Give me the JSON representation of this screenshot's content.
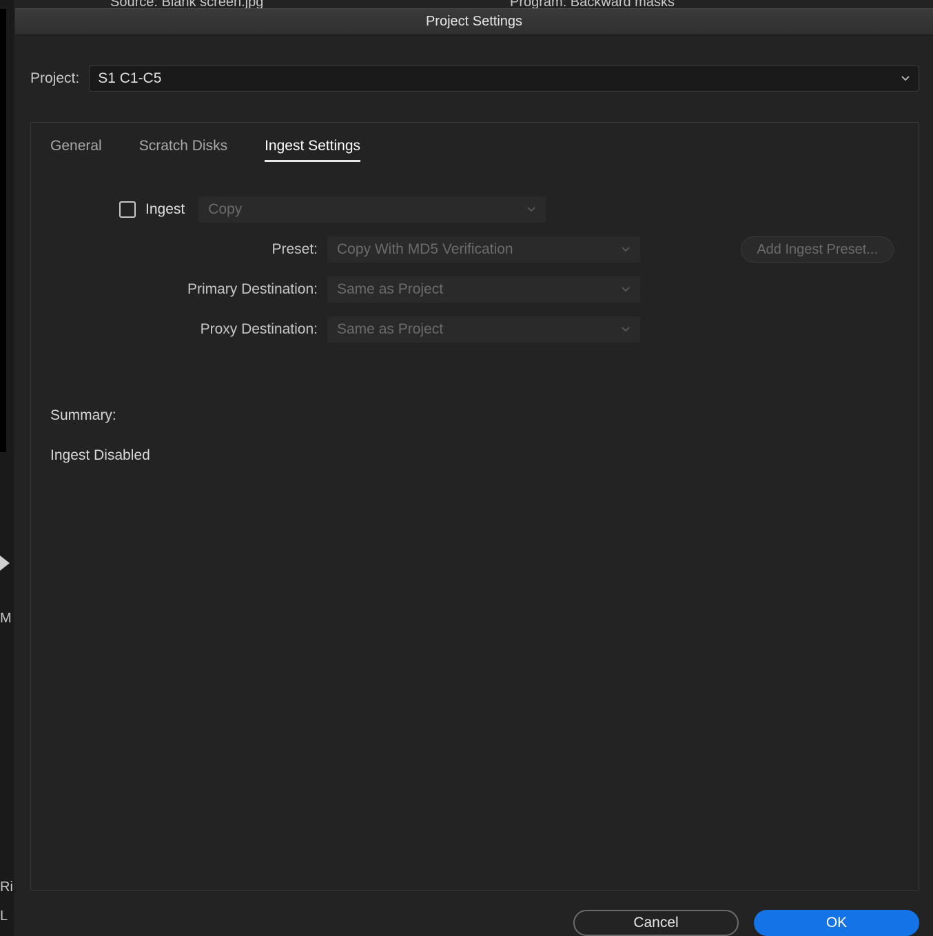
{
  "background": {
    "source_tab": "Source: Blank screen.jpg",
    "program_tab": "Program: Backward masks",
    "left_frag_m": "M",
    "left_frag_ri": "Ri",
    "left_frag_l": "L"
  },
  "dialog": {
    "title": "Project Settings",
    "project_label": "Project:",
    "project_value": "S1 C1-C5",
    "tabs": {
      "general": "General",
      "scratch": "Scratch Disks",
      "ingest": "Ingest Settings"
    },
    "ingest": {
      "checkbox_label": "Ingest",
      "mode_value": "Copy",
      "preset_label": "Preset:",
      "preset_value": "Copy With MD5 Verification",
      "add_preset_btn": "Add Ingest Preset...",
      "primary_dest_label": "Primary Destination:",
      "primary_dest_value": "Same as Project",
      "proxy_dest_label": "Proxy Destination:",
      "proxy_dest_value": "Same as Project"
    },
    "summary": {
      "title": "Summary:",
      "text": "Ingest Disabled"
    },
    "buttons": {
      "cancel": "Cancel",
      "ok": "OK"
    }
  }
}
